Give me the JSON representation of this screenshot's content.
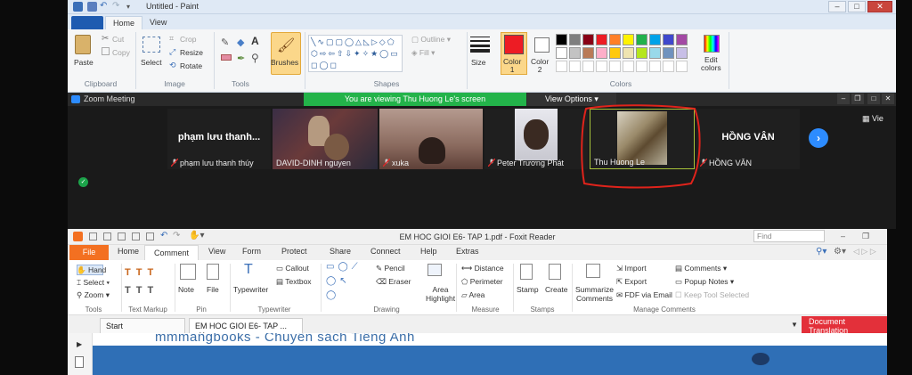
{
  "paint": {
    "title": "Untitled - Paint",
    "tabs": [
      "Home",
      "View"
    ],
    "clipboard": {
      "paste": "Paste",
      "cut": "Cut",
      "copy": "Copy",
      "group": "Clipboard"
    },
    "image": {
      "select": "Select",
      "crop": "Crop",
      "resize": "Resize",
      "rotate": "Rotate",
      "group": "Image"
    },
    "tools_group": "Tools",
    "brushes": "Brushes",
    "shapes": {
      "outline": "Outline",
      "fill": "Fill",
      "group": "Shapes"
    },
    "size": "Size",
    "color1": {
      "line1": "Color",
      "line2": "1"
    },
    "color2": {
      "line1": "Color",
      "line2": "2"
    },
    "colors_group": "Colors",
    "edit_colors": {
      "line1": "Edit",
      "line2": "colors"
    },
    "palette_row1": [
      "#000000",
      "#7f7f7f",
      "#880015",
      "#ed1c24",
      "#ff7f27",
      "#fff200",
      "#22b14c",
      "#00a2e8",
      "#3f48cc",
      "#a349a4"
    ],
    "palette_row2": [
      "#ffffff",
      "#c3c3c3",
      "#b97a57",
      "#ffaec9",
      "#ffc90e",
      "#efe4b0",
      "#b5e61d",
      "#99d9ea",
      "#7092be",
      "#c8bfe7"
    ],
    "accent_color1": "#ed1c24"
  },
  "zoom": {
    "title": "Zoom Meeting",
    "viewing_banner": "You are viewing Thu Huong Le's screen",
    "view_options": "View Options",
    "side_label": "Vie",
    "participants": [
      {
        "name": "phạm lưu thanh thúy",
        "big": "phạm lưu thanh...",
        "muted": true
      },
      {
        "name": "DAVID-DINH nguyen",
        "muted": false
      },
      {
        "name": "xuka",
        "muted": true
      },
      {
        "name": "Peter Trương Phát",
        "muted": true
      },
      {
        "name": "Thu Huong Le",
        "muted": false,
        "active": true
      },
      {
        "name": "HỒNG VÂN",
        "big": "HỒNG VÂN",
        "muted": true
      }
    ]
  },
  "foxit": {
    "title": "EM HOC GIOI E6- TAP 1.pdf - Foxit Reader",
    "file_tab": "File",
    "tabs": [
      "Home",
      "Comment",
      "View",
      "Form",
      "Protect",
      "Share",
      "Connect",
      "Help",
      "Extras"
    ],
    "active_tab": "Comment",
    "find_placeholder": "Find",
    "tools": {
      "hand": "Hand",
      "select": "Select",
      "zoom": "Zoom",
      "group": "Tools"
    },
    "text_markup_group": "Text Markup",
    "pin": {
      "note": "Note",
      "file": "File",
      "group": "Pin"
    },
    "typewriter": {
      "typewriter": "Typewriter",
      "callout": "Callout",
      "textbox": "Textbox",
      "group": "Typewriter"
    },
    "drawing": {
      "pencil": "Pencil",
      "eraser": "Eraser",
      "area_highlight_1": "Area",
      "area_highlight_2": "Highlight",
      "group": "Drawing"
    },
    "measure": {
      "distance": "Distance",
      "perimeter": "Perimeter",
      "area": "Area",
      "group": "Measure"
    },
    "stamps": {
      "stamp": "Stamp",
      "create": "Create",
      "group": "Stamps"
    },
    "manage": {
      "summarize_1": "Summarize",
      "summarize_2": "Comments",
      "import": "Import",
      "export": "Export",
      "fdf": "FDF via Email",
      "comments": "Comments",
      "popup_notes": "Popup Notes",
      "keep_tool": "Keep Tool Selected",
      "group": "Manage Comments"
    },
    "doc_tabs": [
      "Start",
      "EM HOC GIOI E6- TAP ..."
    ],
    "doc_translation": {
      "line1": "Document",
      "line2": "Translation"
    },
    "page_text": "mmmangbooks - Chuyên sách Tiếng Anh"
  }
}
